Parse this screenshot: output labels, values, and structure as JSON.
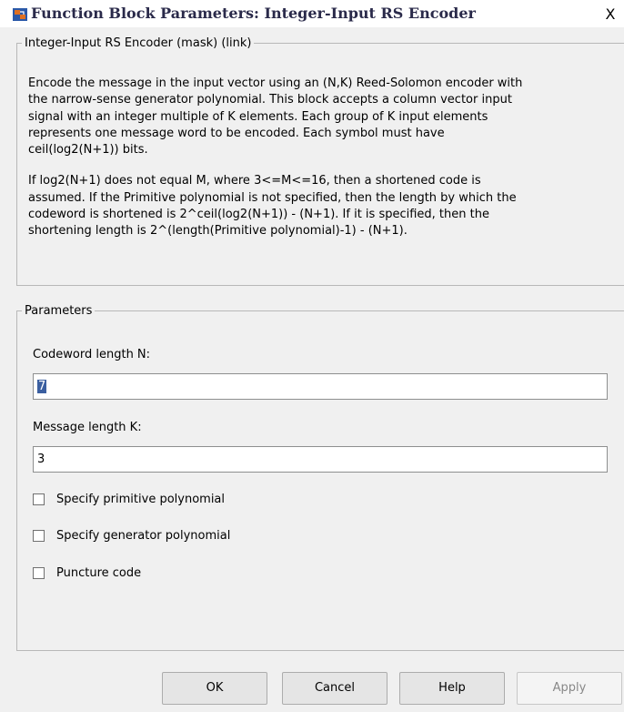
{
  "window": {
    "title": "Function Block Parameters: Integer-Input RS Encoder",
    "close_label": "X"
  },
  "description": {
    "legend": "Integer-Input RS Encoder (mask) (link)",
    "lines_p1": [
      "Encode the message in the input vector using an (N,K) Reed-Solomon encoder with",
      "the narrow-sense generator polynomial.  This block accepts a column vector input",
      "signal with an integer multiple of K elements.  Each group of K input elements",
      "represents one message word to be encoded.  Each symbol must have",
      "ceil(log2(N+1)) bits."
    ],
    "lines_p2": [
      "If log2(N+1) does not equal M, where 3<=M<=16, then a shortened code is",
      "assumed.  If the Primitive polynomial is not specified, then the length by which the",
      "codeword is shortened is 2^ceil(log2(N+1)) - (N+1).  If it is specified, then the",
      "shortening length is 2^(length(Primitive polynomial)-1) - (N+1)."
    ]
  },
  "parameters": {
    "legend": "Parameters",
    "codeword_label": "Codeword length N:",
    "codeword_value": "7",
    "message_label": "Message length K:",
    "message_value": "3",
    "checkboxes": [
      {
        "label": "Specify primitive polynomial",
        "checked": false
      },
      {
        "label": "Specify generator polynomial",
        "checked": false
      },
      {
        "label": "Puncture code",
        "checked": false
      }
    ]
  },
  "buttons": {
    "ok": "OK",
    "cancel": "Cancel",
    "help": "Help",
    "apply": "Apply"
  }
}
